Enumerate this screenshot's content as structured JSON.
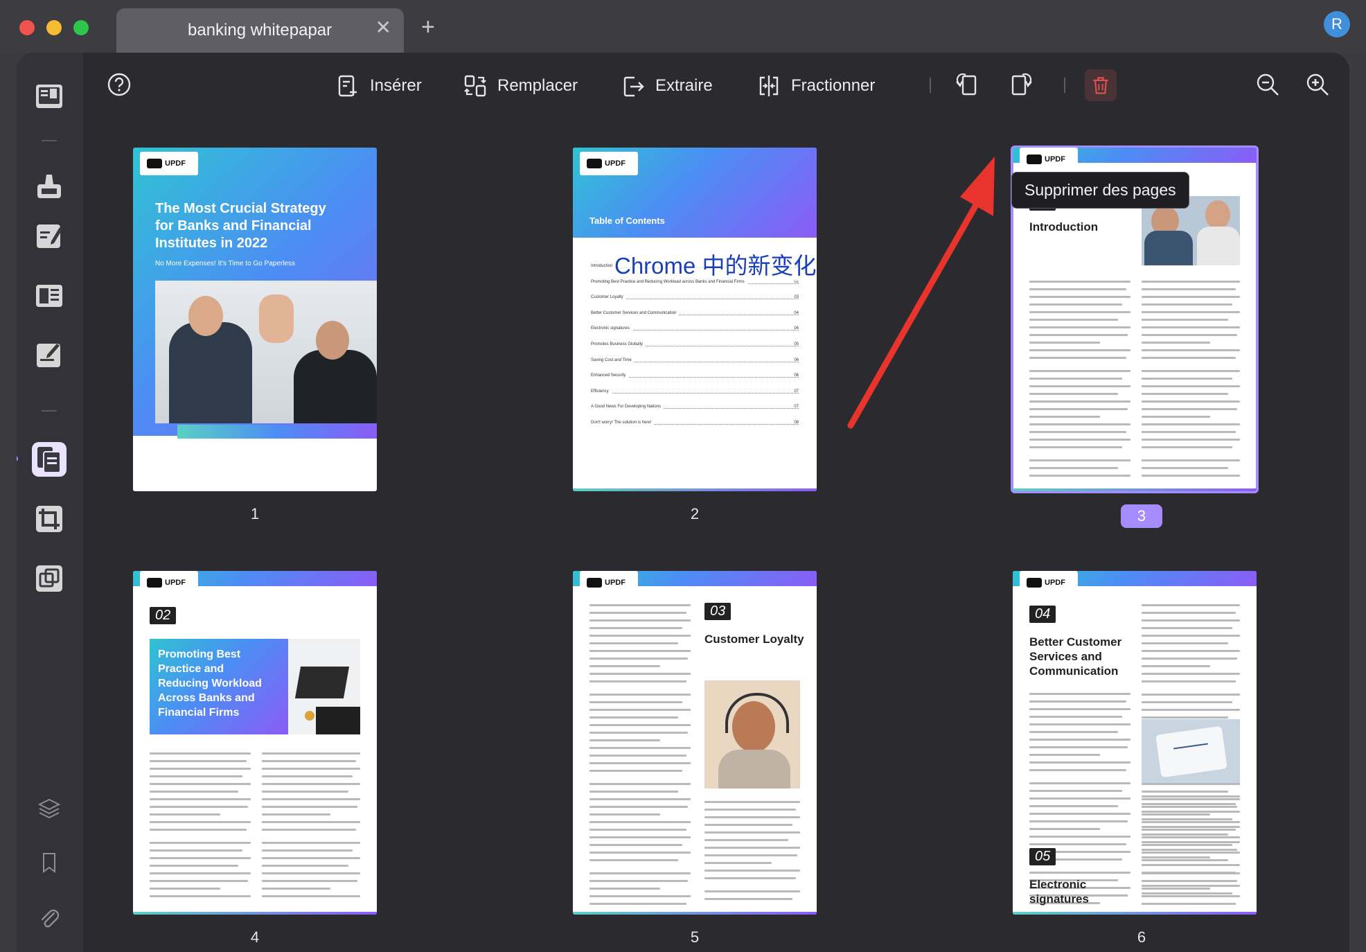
{
  "window": {
    "tab_title": "banking whitepapar",
    "tab_close": "✕",
    "new_tab": "+",
    "avatar_initial": "R"
  },
  "toolbar": {
    "insert": "Insérer",
    "replace": "Remplacer",
    "extract": "Extraire",
    "split": "Fractionner",
    "tooltip": "Supprimer des pages"
  },
  "colors": {
    "accent": "#a58cff",
    "delete": "#e0524d",
    "arrow": "#e8342c"
  },
  "pages": [
    {
      "number": "1",
      "logo": "UPDF",
      "title": "The Most Crucial Strategy for Banks and Financial Institutes in 2022",
      "subtitle": "No More Expenses! It's Time to Go Paperless"
    },
    {
      "number": "2",
      "logo": "UPDF",
      "heading": "Table of Contents",
      "overlay": "Chrome 中的新变化",
      "toc": [
        {
          "label": "Introduction",
          "page": "01"
        },
        {
          "label": "Promoting Best Practice and Reducing Workload across Banks and Financial Firms",
          "page": "02"
        },
        {
          "label": "Customer Loyalty",
          "page": "03"
        },
        {
          "label": "Better Customer Services and Communication",
          "page": "04"
        },
        {
          "label": "Electronic signatures",
          "page": "04"
        },
        {
          "label": "Promotes Business Globally",
          "page": "05"
        },
        {
          "label": "Saving Cost and Time",
          "page": "06"
        },
        {
          "label": "Enhanced Security",
          "page": "06"
        },
        {
          "label": "Efficiency",
          "page": "07"
        },
        {
          "label": "A Good News For Developing Nations",
          "page": "07"
        },
        {
          "label": "Don't worry! The solution is here!",
          "page": "08"
        }
      ]
    },
    {
      "number": "3",
      "logo": "UPDF",
      "section_num": "01",
      "section_title": "Introduction"
    },
    {
      "number": "4",
      "logo": "UPDF",
      "section_num": "02",
      "section_title": "Promoting Best Practice and Reducing Workload Across Banks and Financial Firms"
    },
    {
      "number": "5",
      "logo": "UPDF",
      "section_num": "03",
      "section_title": "Customer Loyalty"
    },
    {
      "number": "6",
      "logo": "UPDF",
      "section_num": "04",
      "section_title": "Better Customer Services and Communication",
      "section_num_b": "05",
      "section_title_b": "Electronic signatures"
    }
  ]
}
